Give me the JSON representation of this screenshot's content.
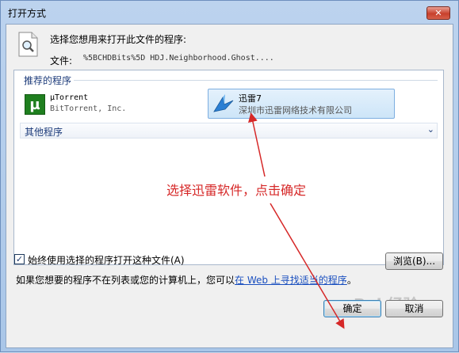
{
  "window": {
    "title": "打开方式",
    "close_label": "✕"
  },
  "header": {
    "prompt": "选择您想用来打开此文件的程序:",
    "file_label": "文件:",
    "file_name": "%5BCHDBits%5D HDJ.Neighborhood.Ghost...."
  },
  "recommended": {
    "header": "推荐的程序",
    "programs": [
      {
        "name": "μTorrent",
        "publisher": "BitTorrent, Inc."
      },
      {
        "name": "迅雷7",
        "publisher": "深圳市迅雷网络技术有限公司"
      }
    ]
  },
  "other": {
    "header": "其他程序"
  },
  "annotation": {
    "text": "选择迅雷软件，点击确定"
  },
  "options": {
    "always_use_label": "始终使用选择的程序打开这种文件(A)",
    "always_use_checked": true,
    "browse_label": "浏览(B)..."
  },
  "footer": {
    "hint_prefix": "如果您想要的程序不在列表或您的计算机上，您可以",
    "hint_link": "在 Web 上寻找适当的程序",
    "hint_suffix": "。"
  },
  "buttons": {
    "ok": "确定",
    "cancel": "取消"
  },
  "watermark": "Bai 经验",
  "colors": {
    "annotation": "#d62828",
    "selection": "#cde5f8",
    "link": "#1a4fbf"
  }
}
